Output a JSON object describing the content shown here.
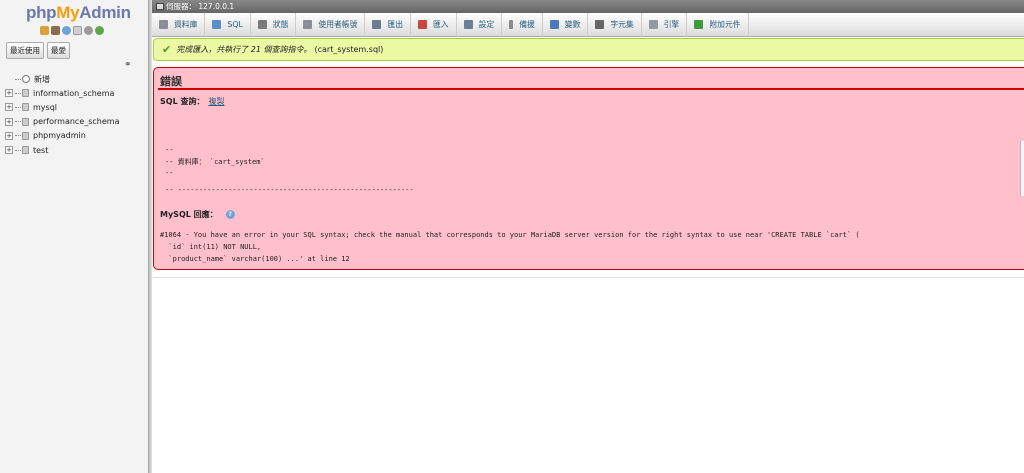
{
  "nav": {
    "logo": {
      "php": "php",
      "my": "My",
      "admin": "Admin"
    },
    "logo_icons": [
      "home-icon",
      "exit-icon",
      "help-icon",
      "docs-icon",
      "settings-icon",
      "reload-icon"
    ],
    "tabs": [
      "最近使用",
      "最愛"
    ],
    "link_icon": "link-icon",
    "tree": [
      {
        "label": "新增",
        "type": "new"
      },
      {
        "label": "information_schema",
        "type": "db"
      },
      {
        "label": "mysql",
        "type": "db"
      },
      {
        "label": "performance_schema",
        "type": "db"
      },
      {
        "label": "phpmyadmin",
        "type": "db"
      },
      {
        "label": "test",
        "type": "db"
      }
    ]
  },
  "serverbar": {
    "label": "伺服器： 127.0.0.1"
  },
  "menu": [
    {
      "label": "資料庫",
      "icon": "database-icon",
      "color": "#8a8f99"
    },
    {
      "label": "SQL",
      "icon": "sql-icon",
      "color": "#5b8fc9"
    },
    {
      "label": "狀態",
      "icon": "status-icon",
      "color": "#7a7a7a"
    },
    {
      "label": "使用者帳號",
      "icon": "users-icon",
      "color": "#8a8f99"
    },
    {
      "label": "匯出",
      "icon": "export-icon",
      "color": "#6d7c92"
    },
    {
      "label": "匯入",
      "icon": "import-icon",
      "color": "#c9483a"
    },
    {
      "label": "設定",
      "icon": "settings-icon",
      "color": "#6a7f99"
    },
    {
      "label": "備援",
      "icon": "replication-icon",
      "color": "#8a8a8a"
    },
    {
      "label": "變數",
      "icon": "variables-icon",
      "color": "#4e78b8"
    },
    {
      "label": "字元集",
      "icon": "charset-icon",
      "color": "#666666"
    },
    {
      "label": "引擎",
      "icon": "engine-icon",
      "color": "#909aa6"
    },
    {
      "label": "附加元件",
      "icon": "plugins-icon",
      "color": "#3d9a3d"
    }
  ],
  "success": {
    "icon": "check-icon",
    "message": "完成匯入，共執行了 21 個查詢指令。",
    "file": "(cart_system.sql)"
  },
  "error": {
    "title": "錯誤",
    "sql_label": "SQL 查詢：",
    "copy_label": "複製",
    "code": "--\n-- 資料庫： `cart_system`\n--",
    "code2": "-- --------------------------------------------------------",
    "mysql_label": "MySQL 回應：",
    "help_icon": "help-icon",
    "response": "#1064 - You have an error in your SQL syntax; check the manual that corresponds to your MariaDB server version for the right syntax to use near 'CREATE TABLE `cart` (\n  `id` int(11) NOT NULL,\n  `product_name` varchar(100) ...' at line 12"
  }
}
